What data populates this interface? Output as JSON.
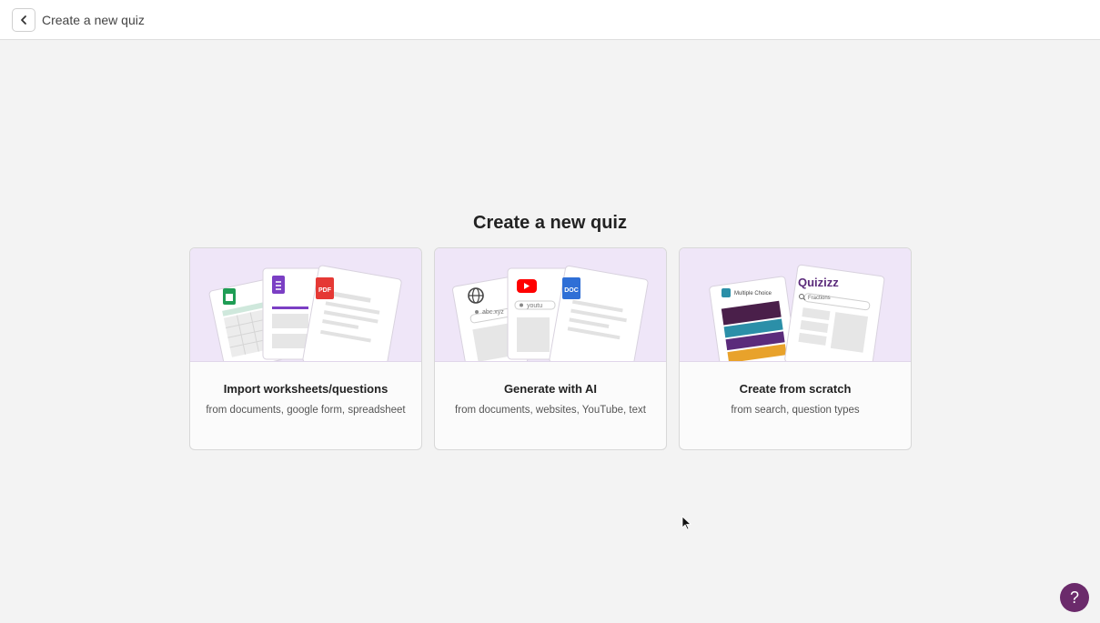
{
  "header": {
    "title": "Create a new quiz",
    "back_icon": "chevron-left-icon"
  },
  "main": {
    "heading": "Create a new quiz",
    "cards": [
      {
        "title": "Import worksheets/questions",
        "subtitle": "from documents, google form, spreadsheet",
        "icons": [
          "sheets-icon",
          "forms-icon",
          "pdf-icon"
        ],
        "badge": "PDF"
      },
      {
        "title": "Generate with AI",
        "subtitle": "from documents, websites, YouTube, text",
        "icons": [
          "globe-icon",
          "youtube-icon",
          "doc-icon"
        ],
        "url_text": "abc.xyz",
        "yt_text": "youtu",
        "badge": "DOC"
      },
      {
        "title": "Create from scratch",
        "subtitle": "from search, question types",
        "question_type": "Multiple Choice",
        "brand": "Quizizz",
        "search_text": "Fractions"
      }
    ]
  },
  "help": {
    "label": "?"
  },
  "colors": {
    "accent": "#6b2a6b",
    "art_bg": "#efe6f8",
    "sheets": "#1f9d55",
    "forms": "#7b3fc4",
    "pdf": "#e53935",
    "youtube": "#ff0000",
    "doc": "#2f6fd6"
  }
}
